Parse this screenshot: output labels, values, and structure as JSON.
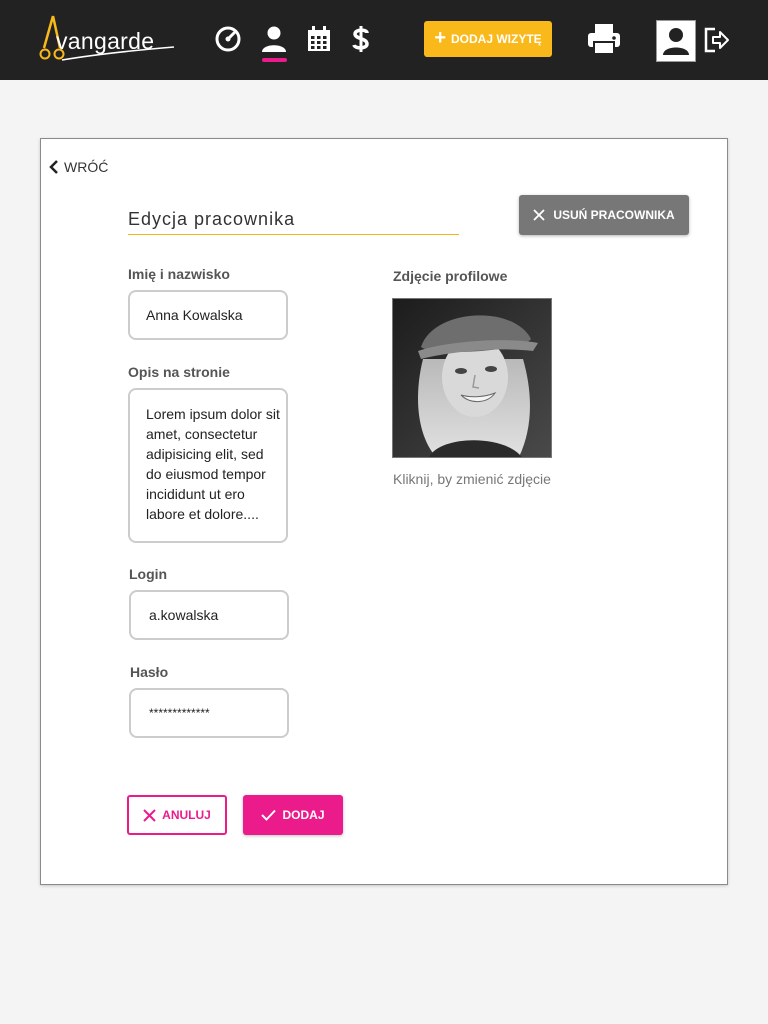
{
  "header": {
    "logo_text": "vangarde",
    "nav_icons": [
      "dashboard-icon",
      "employees-icon",
      "calendar-icon",
      "dollar-icon"
    ],
    "active_nav": "employees",
    "add_visit_label": "DODAJ WIZYTĘ",
    "colors": {
      "bar": "#222222",
      "accent": "#f9b91a",
      "active": "#ec1b8c"
    }
  },
  "back": {
    "label": "WRÓĆ"
  },
  "form": {
    "title": "Edycja pracownika",
    "delete_label": "USUŃ PRACOWNIKA",
    "name_label": "Imię i nazwisko",
    "name_value": "Anna Kowalska",
    "description_label": "Opis na stronie",
    "description_value": "Lorem ipsum dolor sit amet, consectetur adipisicing elit, sed do eiusmod tempor incididunt ut ero labore et dolore....",
    "login_label": "Login",
    "login_value": "a.kowalska",
    "password_label": "Hasło",
    "password_value": "*************",
    "photo_label": "Zdjęcie profilowe",
    "photo_caption": "Kliknij, by zmienić zdjęcie",
    "cancel_label": "ANULUJ",
    "submit_label": "DODAJ"
  }
}
